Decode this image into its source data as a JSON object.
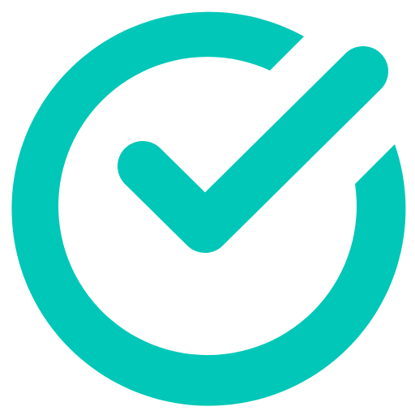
{
  "icon": {
    "name": "check-circle-icon",
    "color": "#00C7B7",
    "background": "#FFFFFF"
  }
}
